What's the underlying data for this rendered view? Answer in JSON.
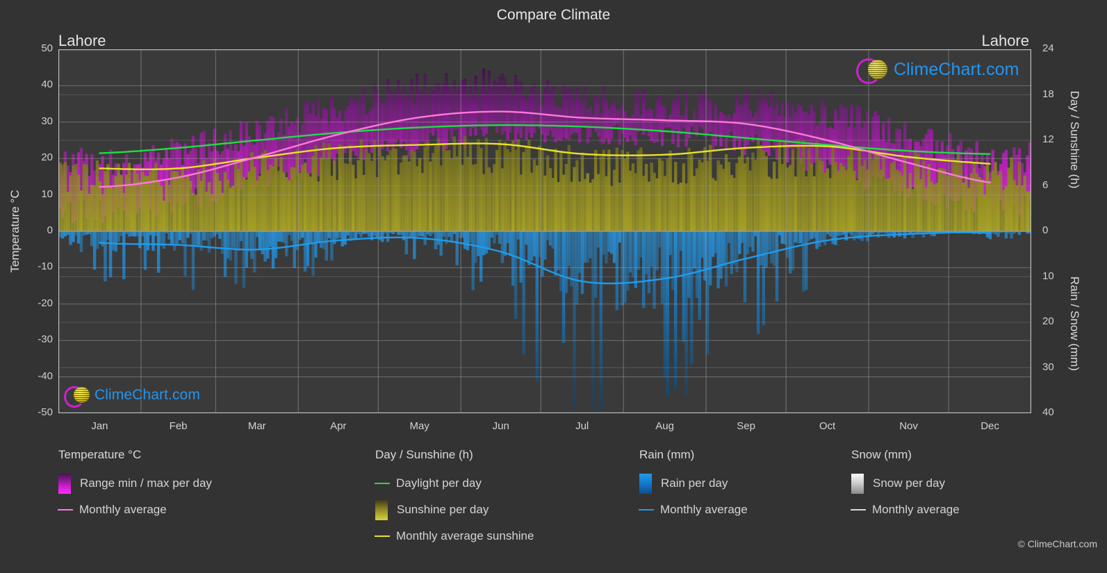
{
  "header": {
    "title": "Compare Climate",
    "location_left": "Lahore",
    "location_right": "Lahore"
  },
  "brand": {
    "name": "ClimeChart.com",
    "copyright": "© ClimeChart.com"
  },
  "axes": {
    "y_left_title": "Temperature °C",
    "y_right_top_title": "Day / Sunshine (h)",
    "y_right_bottom_title": "Rain / Snow (mm)",
    "y_left_ticks": [
      "50",
      "40",
      "30",
      "20",
      "10",
      "0",
      "-10",
      "-20",
      "-30",
      "-40",
      "-50"
    ],
    "y_right_top_ticks": [
      "24",
      "18",
      "12",
      "6",
      "0"
    ],
    "y_right_bottom_ticks": [
      "0",
      "10",
      "20",
      "30",
      "40"
    ],
    "x_ticks": [
      "Jan",
      "Feb",
      "Mar",
      "Apr",
      "May",
      "Jun",
      "Jul",
      "Aug",
      "Sep",
      "Oct",
      "Nov",
      "Dec"
    ]
  },
  "legend": {
    "groups": [
      {
        "title": "Temperature °C",
        "items": [
          {
            "label": "Range min / max per day",
            "marker": "swatch",
            "swatch": "sw-temp"
          },
          {
            "label": "Monthly average",
            "marker": "line",
            "color": "#ff79d8"
          }
        ]
      },
      {
        "title": "Day / Sunshine (h)",
        "items": [
          {
            "label": "Daylight per day",
            "marker": "line",
            "color": "#22dd44"
          },
          {
            "label": "Sunshine per day",
            "marker": "swatch",
            "swatch": "sw-sun"
          },
          {
            "label": "Monthly average sunshine",
            "marker": "line",
            "color": "#e8e22a"
          }
        ]
      },
      {
        "title": "Rain (mm)",
        "items": [
          {
            "label": "Rain per day",
            "marker": "swatch",
            "swatch": "sw-rain"
          },
          {
            "label": "Monthly average",
            "marker": "line",
            "color": "#1f9ceb"
          }
        ]
      },
      {
        "title": "Snow (mm)",
        "items": [
          {
            "label": "Snow per day",
            "marker": "swatch",
            "swatch": "sw-snow"
          },
          {
            "label": "Monthly average",
            "marker": "line",
            "color": "#d8d8d8"
          }
        ]
      }
    ]
  },
  "colors": {
    "background": "#333333",
    "plot_background": "#3a3a3a",
    "grid": "#8a8a8a",
    "temp_range_fill": "#c31ec3",
    "temp_avg_line": "#ff79d8",
    "daylight_line": "#22dd44",
    "sunshine_fill": "#9a941f",
    "sunshine_avg_line": "#e8e22a",
    "rain_fill": "#1b6fae",
    "rain_avg_line": "#1f9ceb",
    "snow_fill": "#d8d8d8"
  },
  "chart_data": {
    "type": "area",
    "title": "Compare Climate",
    "subtitle": "Lahore",
    "xlabel": "",
    "ylabel": "Temperature °C",
    "categories": [
      "Jan",
      "Feb",
      "Mar",
      "Apr",
      "May",
      "Jun",
      "Jul",
      "Aug",
      "Sep",
      "Oct",
      "Nov",
      "Dec"
    ],
    "axis_left": {
      "label": "Temperature °C",
      "min": -50,
      "max": 50,
      "step": 10
    },
    "axis_right_top": {
      "label": "Day / Sunshine (h)",
      "min": 0,
      "max": 24,
      "step": 6
    },
    "axis_right_bottom": {
      "label": "Rain / Snow (mm)",
      "min": 0,
      "max": 40,
      "step": 10
    },
    "grid": true,
    "legend_position": "below",
    "series": [
      {
        "name": "Monthly average",
        "group": "Temperature °C",
        "unit": "°C",
        "axis": "left",
        "color": "#ff79d8",
        "values": [
          12.2,
          14.8,
          20.4,
          26.6,
          31.3,
          32.9,
          31.2,
          30.5,
          29.5,
          25.0,
          18.8,
          13.4
        ]
      },
      {
        "name": "Range max per day",
        "group": "Temperature °C",
        "unit": "°C",
        "axis": "left",
        "color": "#c31ec3",
        "values": [
          19.5,
          22.5,
          28.5,
          35.0,
          40.0,
          41.0,
          37.0,
          35.5,
          35.5,
          33.0,
          27.0,
          21.0
        ]
      },
      {
        "name": "Range min per day",
        "group": "Temperature °C",
        "unit": "°C",
        "axis": "left",
        "color": "#c31ec3",
        "values": [
          5.5,
          8.0,
          13.5,
          19.0,
          24.0,
          27.0,
          27.0,
          26.5,
          24.0,
          17.0,
          10.5,
          6.5
        ]
      },
      {
        "name": "Daylight per day",
        "group": "Day / Sunshine (h)",
        "unit": "h",
        "axis": "right_top",
        "color": "#22dd44",
        "values": [
          10.3,
          11.0,
          12.0,
          13.0,
          13.7,
          14.0,
          13.8,
          13.2,
          12.3,
          11.4,
          10.6,
          10.2
        ]
      },
      {
        "name": "Monthly average sunshine",
        "group": "Day / Sunshine (h)",
        "unit": "h",
        "axis": "right_top",
        "color": "#e8e22a",
        "values": [
          8.3,
          8.3,
          9.7,
          11.0,
          11.4,
          11.5,
          10.2,
          10.1,
          11.0,
          11.2,
          9.8,
          8.9
        ]
      },
      {
        "name": "Rain monthly average",
        "group": "Rain (mm)",
        "unit": "mm",
        "axis": "right_bottom",
        "color": "#1f9ceb",
        "values": [
          2.5,
          3.0,
          4.0,
          2.0,
          1.5,
          4.5,
          11.0,
          10.4,
          6.0,
          2.0,
          0.6,
          0.4
        ]
      },
      {
        "name": "Snow monthly average",
        "group": "Snow (mm)",
        "unit": "mm",
        "axis": "right_bottom",
        "color": "#d8d8d8",
        "values": [
          0,
          0,
          0,
          0,
          0,
          0,
          0,
          0,
          0,
          0,
          0,
          0
        ]
      }
    ]
  }
}
